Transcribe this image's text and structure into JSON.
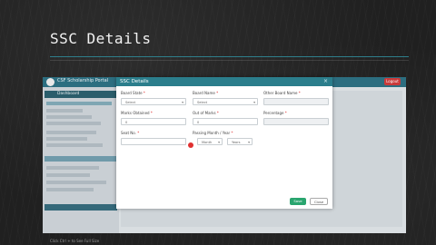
{
  "slide": {
    "title": "SSC Details"
  },
  "app": {
    "name": "CSF Scholarship Portal",
    "logout_label": "Logout"
  },
  "sidebar": {
    "header": "Dashboard"
  },
  "modal": {
    "title": "SSC Details",
    "close": "×",
    "fields": {
      "board_state": {
        "label": "Board State",
        "value": "Select"
      },
      "board_name": {
        "label": "Board Name",
        "value": "Select"
      },
      "other_board_name": {
        "label": "Other Board Name",
        "value": ""
      },
      "marks_obtained": {
        "label": "Marks Obtained",
        "value": "0"
      },
      "out_of_marks": {
        "label": "Out of Marks",
        "value": "0"
      },
      "percentage": {
        "label": "Percentage",
        "value": ""
      },
      "seat_no": {
        "label": "Seat No.",
        "value": ""
      },
      "passing_month_year": {
        "label": "Passing Month / Year",
        "month": "Month",
        "year": "Years"
      }
    },
    "save_label": "Save",
    "close_label": "Close"
  },
  "caption": "Click Ctrl + to See Full Size"
}
